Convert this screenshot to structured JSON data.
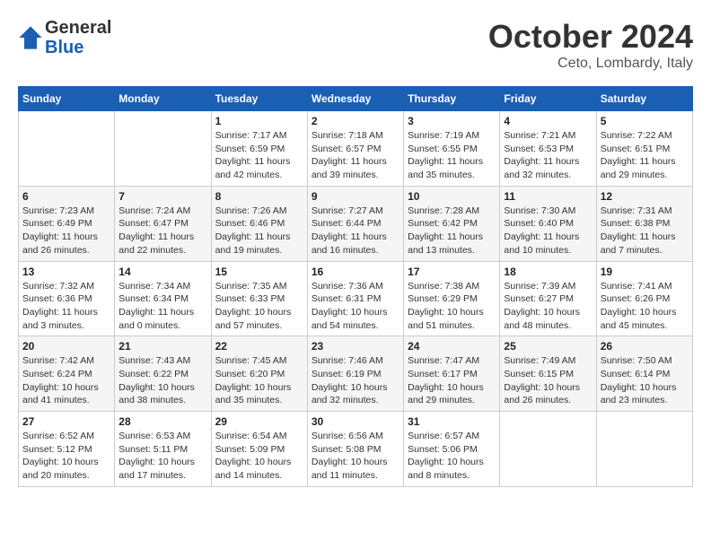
{
  "header": {
    "logo": {
      "general": "General",
      "blue": "Blue"
    },
    "title": "October 2024",
    "subtitle": "Ceto, Lombardy, Italy"
  },
  "calendar": {
    "weekdays": [
      "Sunday",
      "Monday",
      "Tuesday",
      "Wednesday",
      "Thursday",
      "Friday",
      "Saturday"
    ],
    "weeks": [
      [
        {
          "day": "",
          "sunrise": "",
          "sunset": "",
          "daylight": ""
        },
        {
          "day": "",
          "sunrise": "",
          "sunset": "",
          "daylight": ""
        },
        {
          "day": "1",
          "sunrise": "Sunrise: 7:17 AM",
          "sunset": "Sunset: 6:59 PM",
          "daylight": "Daylight: 11 hours and 42 minutes."
        },
        {
          "day": "2",
          "sunrise": "Sunrise: 7:18 AM",
          "sunset": "Sunset: 6:57 PM",
          "daylight": "Daylight: 11 hours and 39 minutes."
        },
        {
          "day": "3",
          "sunrise": "Sunrise: 7:19 AM",
          "sunset": "Sunset: 6:55 PM",
          "daylight": "Daylight: 11 hours and 35 minutes."
        },
        {
          "day": "4",
          "sunrise": "Sunrise: 7:21 AM",
          "sunset": "Sunset: 6:53 PM",
          "daylight": "Daylight: 11 hours and 32 minutes."
        },
        {
          "day": "5",
          "sunrise": "Sunrise: 7:22 AM",
          "sunset": "Sunset: 6:51 PM",
          "daylight": "Daylight: 11 hours and 29 minutes."
        }
      ],
      [
        {
          "day": "6",
          "sunrise": "Sunrise: 7:23 AM",
          "sunset": "Sunset: 6:49 PM",
          "daylight": "Daylight: 11 hours and 26 minutes."
        },
        {
          "day": "7",
          "sunrise": "Sunrise: 7:24 AM",
          "sunset": "Sunset: 6:47 PM",
          "daylight": "Daylight: 11 hours and 22 minutes."
        },
        {
          "day": "8",
          "sunrise": "Sunrise: 7:26 AM",
          "sunset": "Sunset: 6:46 PM",
          "daylight": "Daylight: 11 hours and 19 minutes."
        },
        {
          "day": "9",
          "sunrise": "Sunrise: 7:27 AM",
          "sunset": "Sunset: 6:44 PM",
          "daylight": "Daylight: 11 hours and 16 minutes."
        },
        {
          "day": "10",
          "sunrise": "Sunrise: 7:28 AM",
          "sunset": "Sunset: 6:42 PM",
          "daylight": "Daylight: 11 hours and 13 minutes."
        },
        {
          "day": "11",
          "sunrise": "Sunrise: 7:30 AM",
          "sunset": "Sunset: 6:40 PM",
          "daylight": "Daylight: 11 hours and 10 minutes."
        },
        {
          "day": "12",
          "sunrise": "Sunrise: 7:31 AM",
          "sunset": "Sunset: 6:38 PM",
          "daylight": "Daylight: 11 hours and 7 minutes."
        }
      ],
      [
        {
          "day": "13",
          "sunrise": "Sunrise: 7:32 AM",
          "sunset": "Sunset: 6:36 PM",
          "daylight": "Daylight: 11 hours and 3 minutes."
        },
        {
          "day": "14",
          "sunrise": "Sunrise: 7:34 AM",
          "sunset": "Sunset: 6:34 PM",
          "daylight": "Daylight: 11 hours and 0 minutes."
        },
        {
          "day": "15",
          "sunrise": "Sunrise: 7:35 AM",
          "sunset": "Sunset: 6:33 PM",
          "daylight": "Daylight: 10 hours and 57 minutes."
        },
        {
          "day": "16",
          "sunrise": "Sunrise: 7:36 AM",
          "sunset": "Sunset: 6:31 PM",
          "daylight": "Daylight: 10 hours and 54 minutes."
        },
        {
          "day": "17",
          "sunrise": "Sunrise: 7:38 AM",
          "sunset": "Sunset: 6:29 PM",
          "daylight": "Daylight: 10 hours and 51 minutes."
        },
        {
          "day": "18",
          "sunrise": "Sunrise: 7:39 AM",
          "sunset": "Sunset: 6:27 PM",
          "daylight": "Daylight: 10 hours and 48 minutes."
        },
        {
          "day": "19",
          "sunrise": "Sunrise: 7:41 AM",
          "sunset": "Sunset: 6:26 PM",
          "daylight": "Daylight: 10 hours and 45 minutes."
        }
      ],
      [
        {
          "day": "20",
          "sunrise": "Sunrise: 7:42 AM",
          "sunset": "Sunset: 6:24 PM",
          "daylight": "Daylight: 10 hours and 41 minutes."
        },
        {
          "day": "21",
          "sunrise": "Sunrise: 7:43 AM",
          "sunset": "Sunset: 6:22 PM",
          "daylight": "Daylight: 10 hours and 38 minutes."
        },
        {
          "day": "22",
          "sunrise": "Sunrise: 7:45 AM",
          "sunset": "Sunset: 6:20 PM",
          "daylight": "Daylight: 10 hours and 35 minutes."
        },
        {
          "day": "23",
          "sunrise": "Sunrise: 7:46 AM",
          "sunset": "Sunset: 6:19 PM",
          "daylight": "Daylight: 10 hours and 32 minutes."
        },
        {
          "day": "24",
          "sunrise": "Sunrise: 7:47 AM",
          "sunset": "Sunset: 6:17 PM",
          "daylight": "Daylight: 10 hours and 29 minutes."
        },
        {
          "day": "25",
          "sunrise": "Sunrise: 7:49 AM",
          "sunset": "Sunset: 6:15 PM",
          "daylight": "Daylight: 10 hours and 26 minutes."
        },
        {
          "day": "26",
          "sunrise": "Sunrise: 7:50 AM",
          "sunset": "Sunset: 6:14 PM",
          "daylight": "Daylight: 10 hours and 23 minutes."
        }
      ],
      [
        {
          "day": "27",
          "sunrise": "Sunrise: 6:52 AM",
          "sunset": "Sunset: 5:12 PM",
          "daylight": "Daylight: 10 hours and 20 minutes."
        },
        {
          "day": "28",
          "sunrise": "Sunrise: 6:53 AM",
          "sunset": "Sunset: 5:11 PM",
          "daylight": "Daylight: 10 hours and 17 minutes."
        },
        {
          "day": "29",
          "sunrise": "Sunrise: 6:54 AM",
          "sunset": "Sunset: 5:09 PM",
          "daylight": "Daylight: 10 hours and 14 minutes."
        },
        {
          "day": "30",
          "sunrise": "Sunrise: 6:56 AM",
          "sunset": "Sunset: 5:08 PM",
          "daylight": "Daylight: 10 hours and 11 minutes."
        },
        {
          "day": "31",
          "sunrise": "Sunrise: 6:57 AM",
          "sunset": "Sunset: 5:06 PM",
          "daylight": "Daylight: 10 hours and 8 minutes."
        },
        {
          "day": "",
          "sunrise": "",
          "sunset": "",
          "daylight": ""
        },
        {
          "day": "",
          "sunrise": "",
          "sunset": "",
          "daylight": ""
        }
      ]
    ]
  }
}
